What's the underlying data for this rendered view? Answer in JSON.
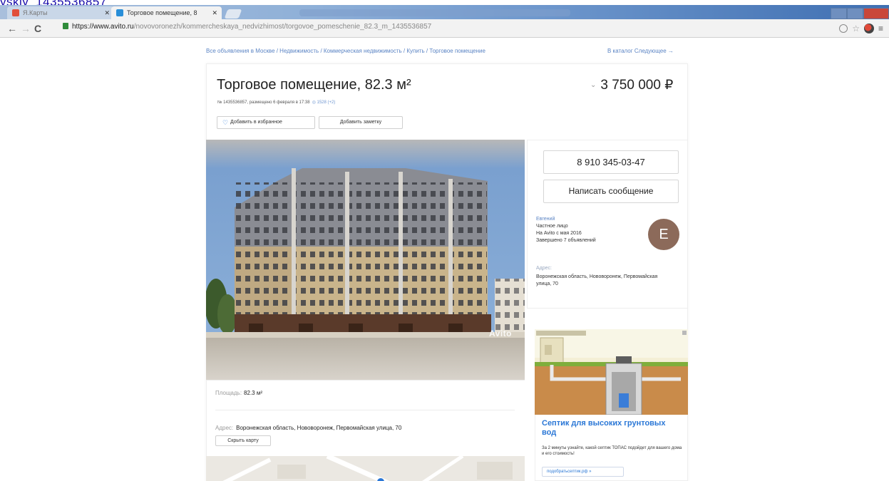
{
  "top_link": "yskiy_1435536857",
  "browser": {
    "tabs": [
      {
        "label": "Я.Карты",
        "active": false
      },
      {
        "label": "Торговое помещение, 8",
        "active": true
      }
    ],
    "url_host": "https://www.avito.ru",
    "url_path": "/novovoronezh/kommercheskaya_nedvizhimost/torgovoe_pomeschenie_82.3_m_1435536857"
  },
  "breadcrumb": "Все объявления в Москве / Недвижимость / Коммерческая недвижимость / Купить / Торговое помещение",
  "catalog_link": "В каталог  Следующее →",
  "listing": {
    "title": "Торговое помещение, 82.3 м²",
    "price": "3 750 000 ₽",
    "meta": "№ 1435536857, размещено 6 февраля в 17:38",
    "views": "1528 (+2)",
    "favorite_label": "Добавить в избранное",
    "note_label": "Добавить заметку",
    "photo_watermark": "Avito",
    "area_label": "Площадь:",
    "area_value": "82.3 м²",
    "address_label": "Адрес:",
    "address_value": "Воронежская область, Нововоронеж, Первомайская улица, 70",
    "map_button": "Скрыть карту"
  },
  "seller": {
    "phone": "8 910 345-03-47",
    "message_button": "Написать сообщение",
    "name": "Евгений",
    "type": "Частное лицо",
    "since": "На Avito с мая 2016",
    "completed": "Завершено 7 объявлений",
    "avatar_letter": "Е",
    "address_label": "Адрес:",
    "address": "Воронежская область, Нововоронеж, Первомайская улица, 70"
  },
  "ad": {
    "title": "Септик для высоких грунтовых вод",
    "text": "За 2 минуты узнайте, какой септик ТОПАС подойдет для вашего дома и его стоимость!",
    "button": "подобратьсептик.рф »"
  },
  "colors": {
    "link": "#5b84c4",
    "ad_link": "#2a77d6",
    "avatar": "#8c6a5a"
  }
}
